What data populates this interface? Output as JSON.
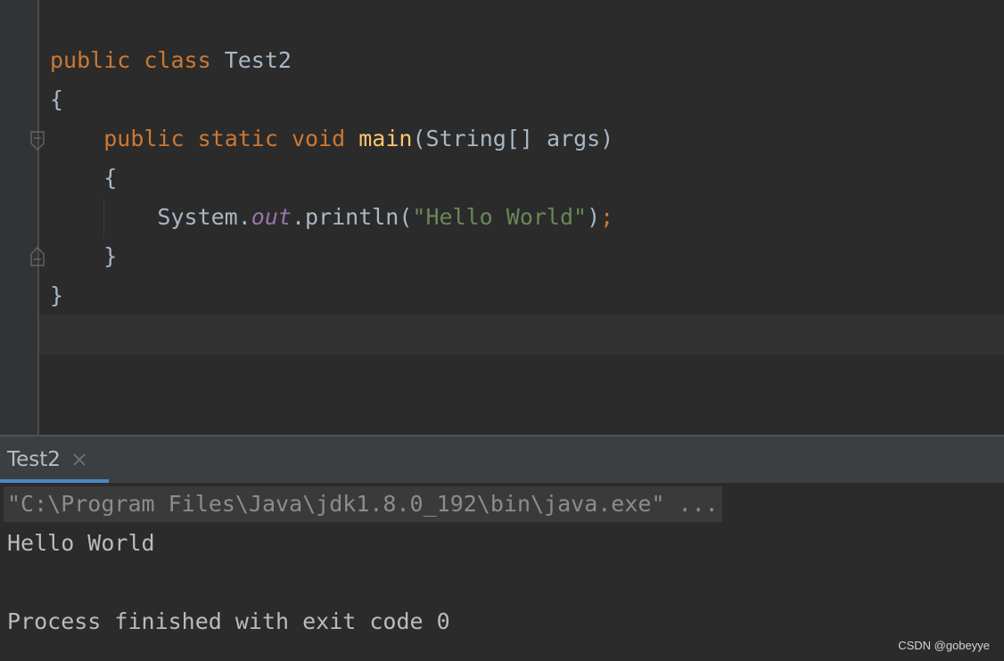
{
  "editor": {
    "lines": [
      {
        "parts": [
          {
            "text": "public",
            "cls": "kw"
          },
          {
            "text": " ",
            "cls": "txt"
          },
          {
            "text": "class",
            "cls": "kw"
          },
          {
            "text": " Test2",
            "cls": "txt"
          }
        ]
      },
      {
        "parts": [
          {
            "text": "{",
            "cls": "txt"
          }
        ]
      },
      {
        "parts": [
          {
            "text": "    ",
            "cls": "txt"
          },
          {
            "text": "public",
            "cls": "kw"
          },
          {
            "text": " ",
            "cls": "txt"
          },
          {
            "text": "static",
            "cls": "kw"
          },
          {
            "text": " ",
            "cls": "txt"
          },
          {
            "text": "void",
            "cls": "kw"
          },
          {
            "text": " ",
            "cls": "txt"
          },
          {
            "text": "main",
            "cls": "fn"
          },
          {
            "text": "(String[] args)",
            "cls": "txt"
          }
        ]
      },
      {
        "parts": [
          {
            "text": "    {",
            "cls": "txt"
          }
        ]
      },
      {
        "parts": [
          {
            "text": "        System.",
            "cls": "txt"
          },
          {
            "text": "out",
            "cls": "field"
          },
          {
            "text": ".println(",
            "cls": "txt"
          },
          {
            "text": "\"Hello World\"",
            "cls": "str"
          },
          {
            "text": ")",
            "cls": "txt"
          },
          {
            "text": ";",
            "cls": "kw"
          }
        ]
      },
      {
        "parts": [
          {
            "text": "    }",
            "cls": "txt"
          }
        ]
      },
      {
        "parts": [
          {
            "text": "}",
            "cls": "txt"
          }
        ]
      }
    ]
  },
  "run_window": {
    "tab_label": "Test2",
    "close_icon": "close-icon",
    "command": "\"C:\\Program Files\\Java\\jdk1.8.0_192\\bin\\java.exe\" ...",
    "output": "Hello World",
    "exit_message": "Process finished with exit code 0"
  },
  "watermark": "CSDN @gobeyye",
  "colors": {
    "editor_bg": "#2b2b2b",
    "keyword": "#cc7832",
    "function": "#ffc66d",
    "field": "#9876aa",
    "string": "#6a8759",
    "text": "#a9b7c6"
  }
}
